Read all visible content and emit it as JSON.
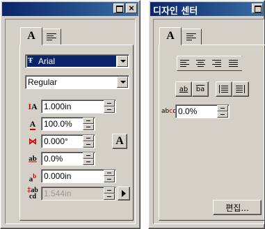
{
  "panel_left": {
    "title": "",
    "tabs": [
      {
        "label": "A",
        "icon": "character-tab-icon"
      },
      {
        "icon": "paragraph-tab-icon"
      }
    ],
    "font_family": {
      "icon": "truetype-icon",
      "value": "Arial"
    },
    "font_style": {
      "value": "Regular"
    },
    "fields": [
      {
        "name": "size",
        "icon": "font-size-icon",
        "value": "1.000in"
      },
      {
        "name": "horizontal-scale",
        "icon": "horizontal-scale-icon",
        "value": "100.0%"
      },
      {
        "name": "skew",
        "icon": "skew-icon",
        "value": "0.000°"
      },
      {
        "name": "tracking",
        "icon": "tracking-icon",
        "value": "0.0%"
      },
      {
        "name": "baseline-shift",
        "icon": "baseline-shift-icon",
        "value": "0.000in"
      },
      {
        "name": "leading",
        "icon": "leading-icon",
        "value": "1.544in",
        "disabled": true
      }
    ],
    "font_button_label": "A"
  },
  "panel_right": {
    "title": "디자인 센터",
    "tabs": [
      {
        "label": "A",
        "icon": "character-tab-icon"
      },
      {
        "icon": "paragraph-tab-icon"
      }
    ],
    "alignment_icons": [
      "align-left-icon",
      "align-center-icon",
      "align-right-icon",
      "align-justify-icon"
    ],
    "spacing_icons": [
      "text-direction-icon",
      "text-direction-alt-icon",
      "indent-icon",
      "outdent-icon"
    ],
    "spacing_field": {
      "icon": "character-spacing-icon",
      "value": "0.0%"
    },
    "edit_button_label": "편집..."
  }
}
